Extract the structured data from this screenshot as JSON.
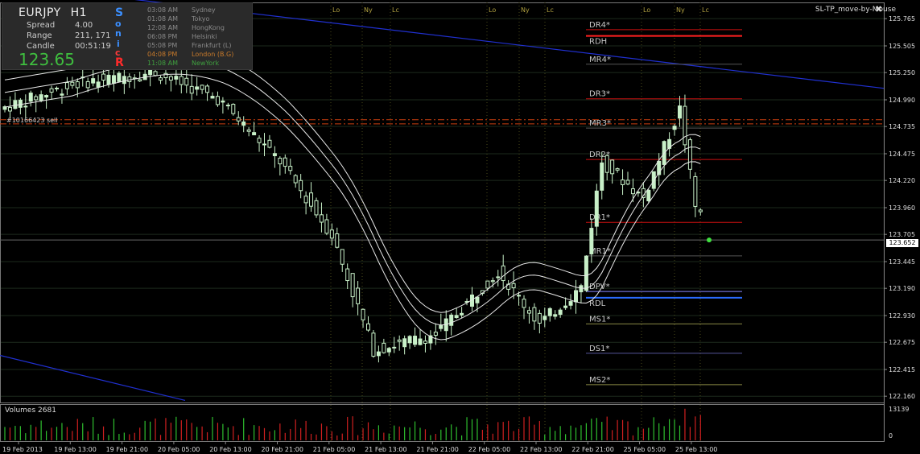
{
  "symbol": "EURJPY",
  "timeframe": "H1",
  "spread_label": "Spread",
  "spread_value": "4.00",
  "range_label": "Range",
  "range_value": "211, 171",
  "candle_label": "Candle",
  "candle_value": "00:51:19",
  "bid_big": "123.65",
  "sonic_letters": [
    "S",
    "o",
    "n",
    "i",
    "c"
  ],
  "sonic_r": "R",
  "sessions": [
    {
      "time": "03:08 AM",
      "city": "Sydney"
    },
    {
      "time": "01:08 AM",
      "city": "Tokyo"
    },
    {
      "time": "12:08 AM",
      "city": "HongKong"
    },
    {
      "time": "06:08 PM",
      "city": "Helsinki"
    },
    {
      "time": "05:08 PM",
      "city": "Frankfurt  (L)"
    },
    {
      "time": "04:08 PM",
      "city": "London  (B.G)"
    },
    {
      "time": "11:08 AM",
      "city": "NewYork"
    }
  ],
  "indicator_title": "SL-TP_move-by-Mouse",
  "close_glyph": "✖",
  "trade_label": "#10166423 sell",
  "current_price": "123.652",
  "volumes_label": "Volumes 2681",
  "volume_max": "13139",
  "volume_min": "0",
  "session_markers": [
    "Lo",
    "Ny",
    "Lc"
  ],
  "price_axis": [
    "125.765",
    "125.505",
    "125.250",
    "124.990",
    "124.735",
    "124.475",
    "124.220",
    "123.960",
    "123.705",
    "123.445",
    "123.190",
    "122.930",
    "122.675",
    "122.415",
    "122.160"
  ],
  "time_axis": [
    "19 Feb 2013",
    "19 Feb 13:00",
    "19 Feb 21:00",
    "20 Feb 05:00",
    "20 Feb 13:00",
    "20 Feb 21:00",
    "21 Feb 05:00",
    "21 Feb 13:00",
    "21 Feb 21:00",
    "22 Feb 05:00",
    "22 Feb 13:00",
    "22 Feb 21:00",
    "25 Feb 05:00",
    "25 Feb 13:00"
  ],
  "pivot_levels": [
    {
      "name": "DR4*",
      "price": 125.66,
      "color": "#cc1111"
    },
    {
      "name": "RDH",
      "price": 125.6,
      "color": "#ff2020",
      "label_below": true
    },
    {
      "name": "MR4*",
      "price": 125.33,
      "color": "#555555"
    },
    {
      "name": "DR3*",
      "price": 125.0,
      "color": "#cc1111"
    },
    {
      "name": "MR3*",
      "price": 124.72,
      "color": "#555555"
    },
    {
      "name": "DR2*",
      "price": 124.42,
      "color": "#cc1111"
    },
    {
      "name": "DR1*",
      "price": 123.82,
      "color": "#cc1111"
    },
    {
      "name": "MR1*",
      "price": 123.5,
      "color": "#555555"
    },
    {
      "name": "DPV*",
      "price": 123.16,
      "color": "#8888ff"
    },
    {
      "name": "RDL",
      "price": 123.1,
      "color": "#2a6bff",
      "label_below": true
    },
    {
      "name": "MS1*",
      "price": 122.85,
      "color": "#888844"
    },
    {
      "name": "DS1*",
      "price": 122.57,
      "color": "#555599"
    },
    {
      "name": "MS2*",
      "price": 122.27,
      "color": "#888844"
    }
  ]
}
